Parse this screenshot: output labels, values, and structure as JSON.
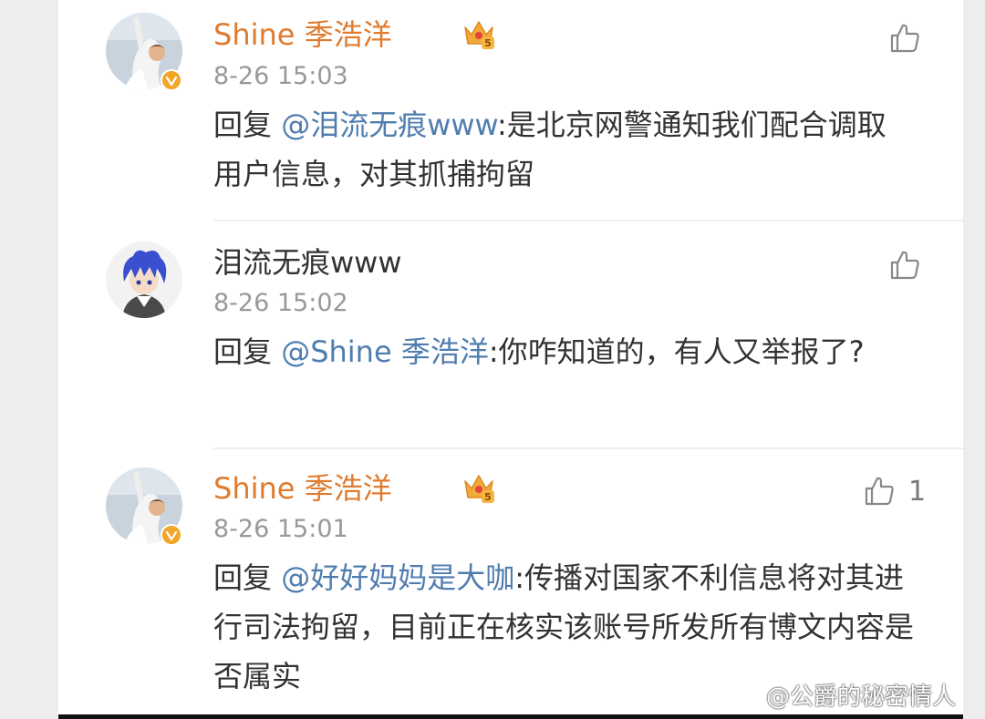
{
  "comments": [
    {
      "username": "Shine 季浩洋",
      "time": "8-26 15:03",
      "reply_prefix": "回复 ",
      "mention": "@泪流无痕www",
      "body": ":是北京网警通知我们配合调取用户信息，对其抓捕拘留",
      "likes": "",
      "vip_level": "5",
      "verified": true
    },
    {
      "username": "泪流无痕www",
      "time": "8-26 15:02",
      "reply_prefix": "回复 ",
      "mention": "@Shine 季浩洋",
      "body": ":你咋知道的，有人又举报了?",
      "likes": ""
    },
    {
      "username": "Shine 季浩洋",
      "time": "8-26 15:01",
      "reply_prefix": "回复 ",
      "mention": "@好好妈妈是大咖",
      "body": ":传播对国家不利信息将对其进行司法拘留，目前正在核实该账号所发所有博文内容是否属实",
      "likes": "1",
      "vip_level": "5",
      "verified": true
    }
  ],
  "watermark": {
    "text": "@公爵的秘密情人",
    "icon": "weibo-logo-icon"
  },
  "colors": {
    "vip_name": "#e07b2e",
    "mention": "#507daf",
    "time": "#999999",
    "text": "#333333",
    "verified_badge": "#f3a525"
  }
}
